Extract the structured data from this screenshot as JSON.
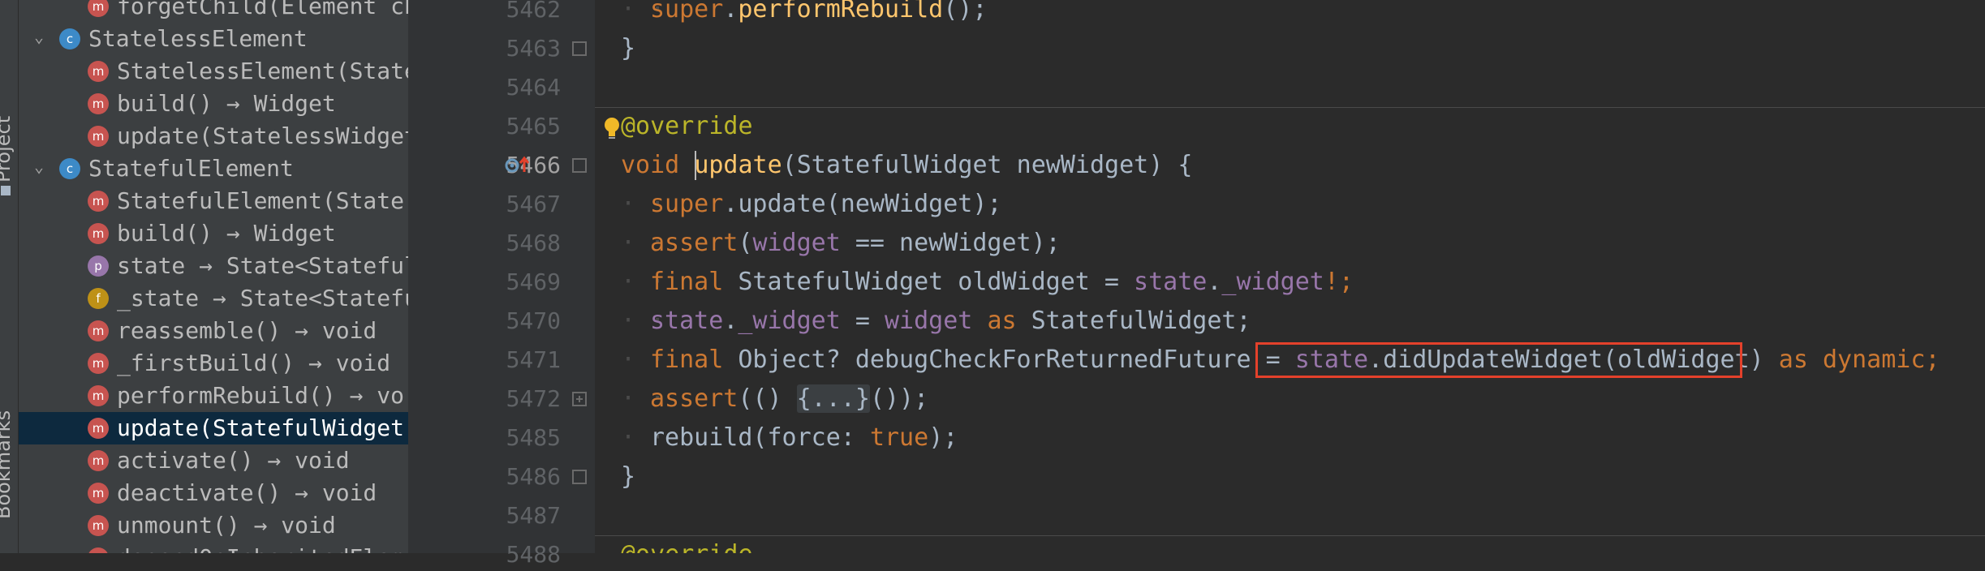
{
  "tool_strip": {
    "project_label": "Project",
    "bookmarks_label": "Bookmarks"
  },
  "structure_tree": [
    {
      "label": "forgetChild(Element ch",
      "badge": "m",
      "indent": 2
    },
    {
      "label": "StatelessElement",
      "badge": "c",
      "indent": 1,
      "expanded": true
    },
    {
      "label": "StatelessElement(State",
      "badge": "m",
      "indent": 2
    },
    {
      "label": "build() → Widget",
      "badge": "m",
      "indent": 2
    },
    {
      "label": "update(StatelessWidget",
      "badge": "m",
      "indent": 2
    },
    {
      "label": "StatefulElement",
      "badge": "c",
      "indent": 1,
      "expanded": true
    },
    {
      "label": "StatefulElement(State",
      "badge": "m",
      "indent": 2
    },
    {
      "label": "build() → Widget",
      "badge": "m",
      "indent": 2
    },
    {
      "label": "state → State<Stateful",
      "badge": "p",
      "indent": 2
    },
    {
      "label": "_state → State<Statefu",
      "badge": "f",
      "indent": 2
    },
    {
      "label": "reassemble() → void",
      "badge": "m",
      "indent": 2
    },
    {
      "label": "_firstBuild() → void",
      "badge": "m",
      "indent": 2
    },
    {
      "label": "performRebuild() → vo",
      "badge": "m",
      "indent": 2
    },
    {
      "label": "update(StatefulWidget",
      "badge": "m",
      "indent": 2,
      "selected": true
    },
    {
      "label": "activate() → void",
      "badge": "m",
      "indent": 2
    },
    {
      "label": "deactivate() → void",
      "badge": "m",
      "indent": 2
    },
    {
      "label": "unmount() → void",
      "badge": "m",
      "indent": 2
    },
    {
      "label": "dependOnInheritedElem",
      "badge": "m",
      "indent": 2
    }
  ],
  "colors": {
    "badge_m": "#c75450",
    "badge_c": "#3d8ac7",
    "badge_p": "#9876aa",
    "badge_f": "#be9117",
    "highlight_box": "#e4412b"
  },
  "gutter_lines": [
    "5462",
    "5463",
    "5464",
    "5465",
    "5466",
    "5467",
    "5468",
    "5469",
    "5470",
    "5471",
    "5472",
    "5485",
    "5486",
    "5487",
    "5488"
  ],
  "current_line": "5466",
  "code_lines": [
    {
      "n": "5462",
      "dots": "··",
      "tokens": [
        [
          "kw",
          "super"
        ],
        [
          "",
          "."
        ],
        [
          "fn",
          "performRebuild"
        ],
        [
          "",
          "();"
        ]
      ]
    },
    {
      "n": "5463",
      "dots": "",
      "tokens": [
        [
          "",
          "}"
        ]
      ]
    },
    {
      "n": "5464",
      "dots": "",
      "tokens": []
    },
    {
      "n": "5465",
      "dots": "",
      "tokens": [
        [
          "ann",
          "@override"
        ]
      ]
    },
    {
      "n": "5466",
      "dots": "",
      "tokens": [
        [
          "kw",
          "void "
        ],
        [
          "fn",
          "update"
        ],
        [
          "",
          "(StatefulWidget newWidget) {"
        ]
      ]
    },
    {
      "n": "5467",
      "dots": "··",
      "tokens": [
        [
          "kw",
          "super"
        ],
        [
          "",
          ".update(newWidget);"
        ]
      ]
    },
    {
      "n": "5468",
      "dots": "··",
      "tokens": [
        [
          "kw",
          "assert"
        ],
        [
          "",
          "("
        ],
        [
          "fld",
          "widget"
        ],
        [
          "",
          " == newWidget);"
        ]
      ]
    },
    {
      "n": "5469",
      "dots": "··",
      "tokens": [
        [
          "kw",
          "final "
        ],
        [
          "",
          "StatefulWidget oldWidget = "
        ],
        [
          "fld",
          "state"
        ],
        [
          "",
          "."
        ],
        [
          "fld",
          "_widget"
        ],
        [
          "kw",
          "!;"
        ]
      ]
    },
    {
      "n": "5470",
      "dots": "··",
      "tokens": [
        [
          "fld",
          "state"
        ],
        [
          "",
          "."
        ],
        [
          "fld",
          "_widget"
        ],
        [
          "",
          " = "
        ],
        [
          "fld",
          "widget"
        ],
        [
          "",
          " "
        ],
        [
          "kw",
          "as "
        ],
        [
          "",
          "StatefulWidget;"
        ]
      ]
    },
    {
      "n": "5471",
      "dots": "··",
      "tokens": [
        [
          "kw",
          "final "
        ],
        [
          "",
          "Object? debugCheckForReturnedFuture = "
        ],
        [
          "fld",
          "state"
        ],
        [
          "",
          ".didUpdateWidget(oldWidget)"
        ],
        [
          "",
          " "
        ],
        [
          "kw",
          "as dynamic;"
        ]
      ]
    },
    {
      "n": "5472",
      "dots": "··",
      "tokens": [
        [
          "kw",
          "assert"
        ],
        [
          "",
          "(() "
        ],
        [
          "fold",
          "{...}"
        ],
        [
          "",
          "());"
        ]
      ]
    },
    {
      "n": "5485",
      "dots": "··",
      "tokens": [
        [
          "",
          "rebuild(force: "
        ],
        [
          "kw",
          "true"
        ],
        [
          "",
          ");"
        ]
      ]
    },
    {
      "n": "5486",
      "dots": "",
      "tokens": [
        [
          "",
          "}"
        ]
      ]
    },
    {
      "n": "5487",
      "dots": "",
      "tokens": []
    },
    {
      "n": "5488",
      "dots": "",
      "tokens": [
        [
          "ann",
          "@override"
        ]
      ]
    }
  ]
}
